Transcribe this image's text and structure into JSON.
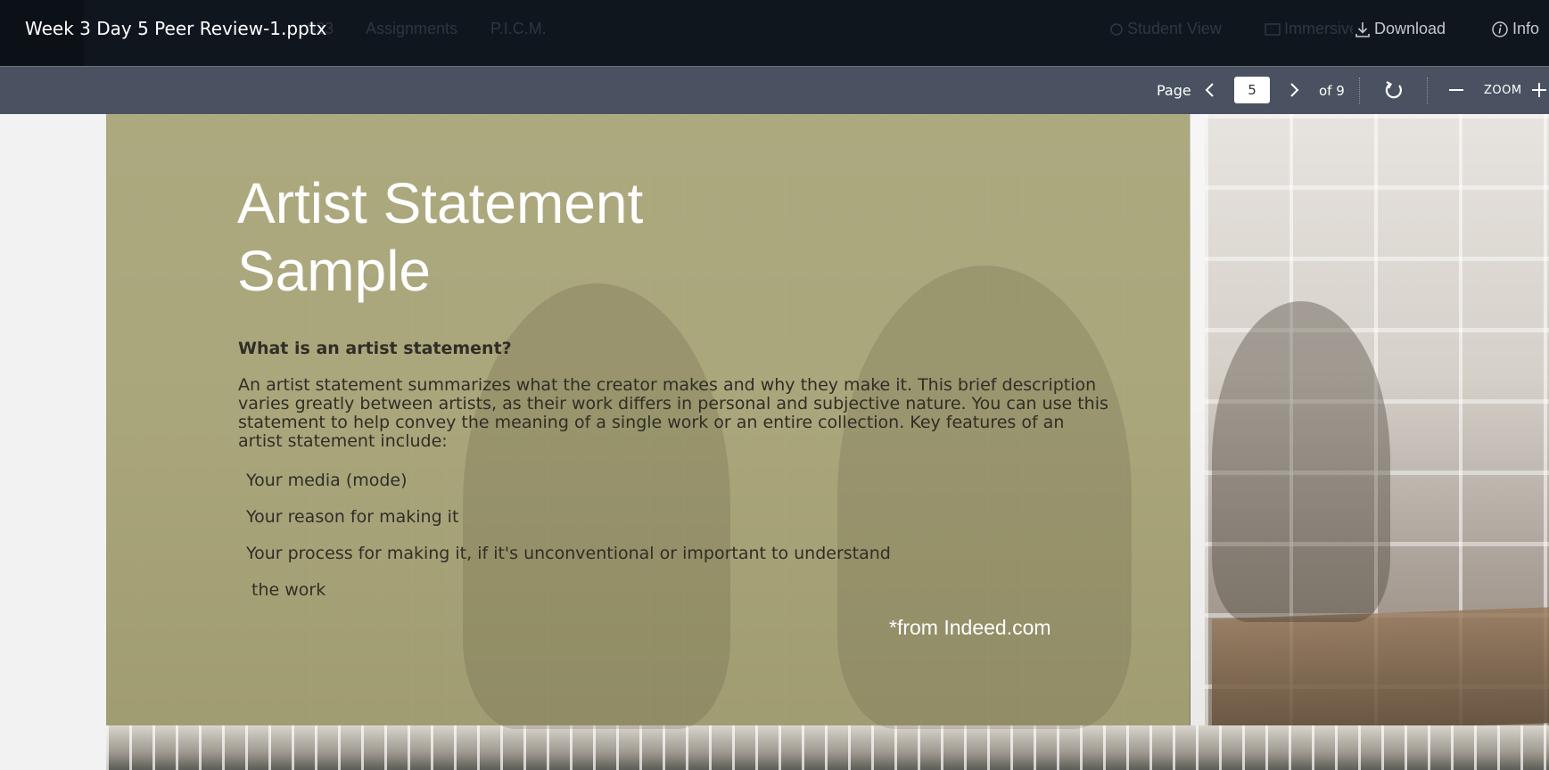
{
  "header": {
    "file_title": "Week 3 Day 5 Peer Review-1.pptx",
    "background_nav": [
      "023",
      "Assignments",
      "P.I.C.M."
    ],
    "actions": {
      "student_view": "Student View",
      "immersive": "Immersive",
      "download": "Download",
      "info": "Info"
    }
  },
  "toolbar": {
    "page_label": "Page",
    "current_page": "5",
    "page_total": "of 9",
    "zoom_label": "ZOOM"
  },
  "slide": {
    "title_line1": "Artist Statement",
    "title_line2": "Sample",
    "question": "What is an artist statement?",
    "body": "An artist statement summarizes what the creator makes and why they make it. This brief description varies greatly between artists, as their work differs in personal and subjective nature. You can use this statement to help convey the meaning of a single work or an entire collection. Key features of an artist statement include:",
    "features": [
      "Your media (mode)",
      "Your reason for making it",
      "Your process for making it, if it's unconventional or important to understand",
      "the work"
    ],
    "source": "*from Indeed.com"
  },
  "colors": {
    "topbar": "#10161d",
    "toolbar": "#4a5261",
    "slide_overlay": "#a8a474",
    "title_text": "#ffffff",
    "body_text": "#2f2e26"
  },
  "icons": {
    "download": "download-icon",
    "info": "info-icon",
    "prev_page": "chevron-left-icon",
    "next_page": "chevron-right-icon",
    "rotate": "rotate-icon",
    "zoom_out": "minus-icon",
    "zoom_in": "plus-icon"
  }
}
